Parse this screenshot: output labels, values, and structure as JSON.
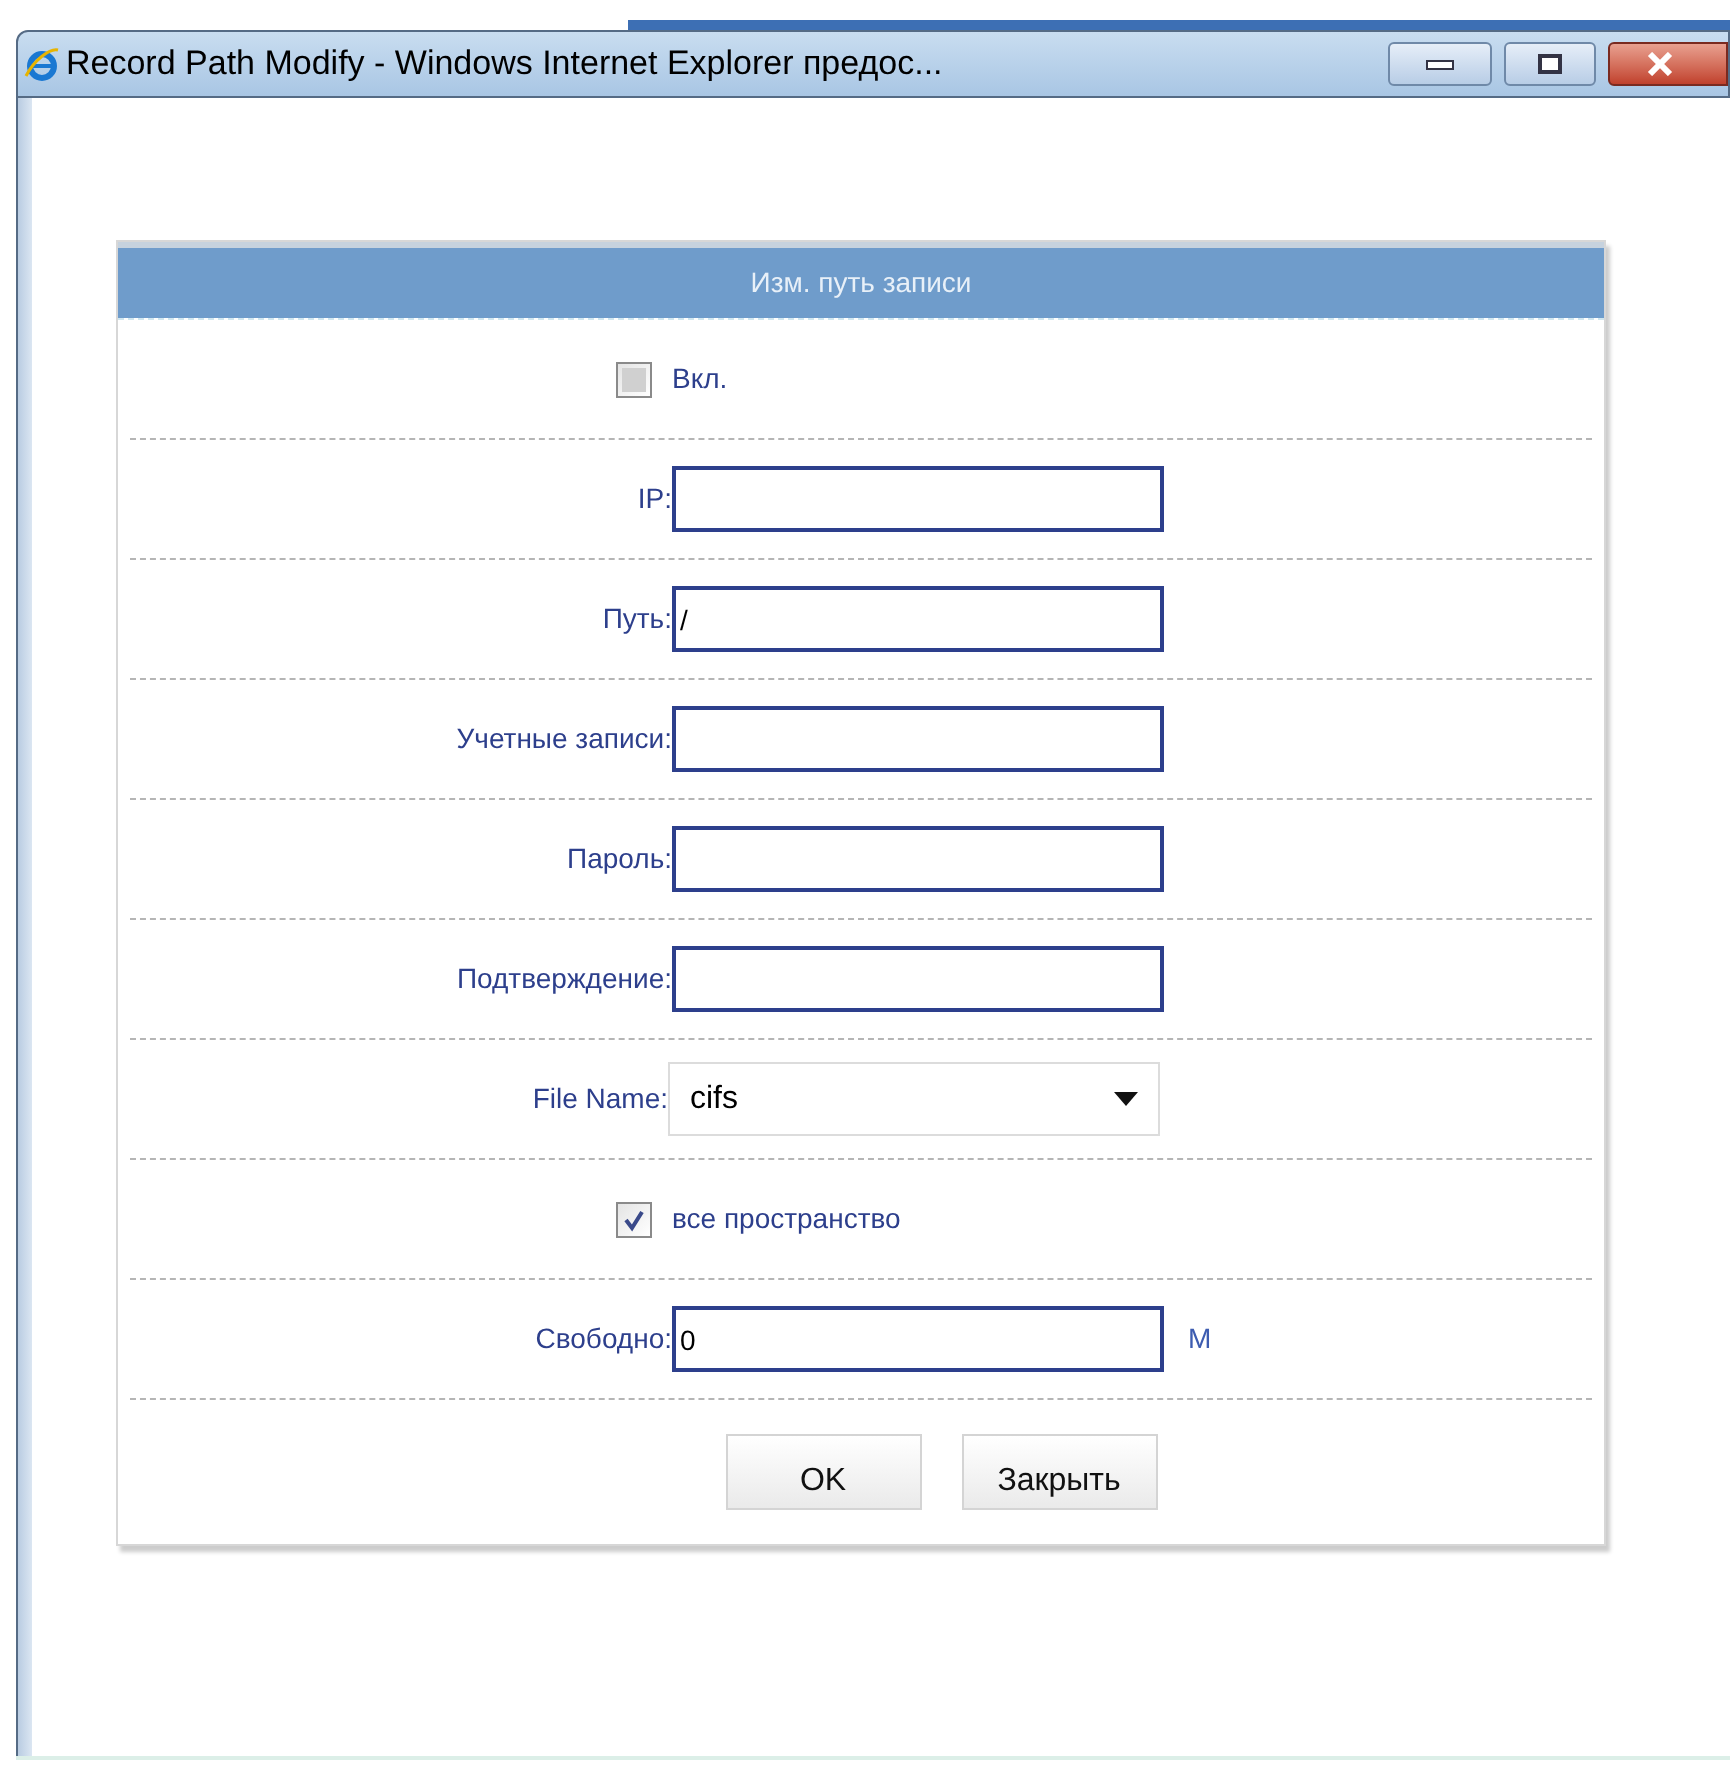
{
  "window": {
    "title": "Record Path Modify - Windows Internet Explorer предос..."
  },
  "form": {
    "title": "Изм. путь записи",
    "rows": [
      {
        "kind": "checkbox",
        "label": "Вкл.",
        "checked": false
      },
      {
        "kind": "text",
        "label": "IP:"
      },
      {
        "kind": "text",
        "label": "Путь:",
        "value": "/"
      },
      {
        "kind": "text",
        "label": "Учетные записи:"
      },
      {
        "kind": "text",
        "label": "Пароль:"
      },
      {
        "kind": "text",
        "label": "Подтверждение:"
      },
      {
        "kind": "select",
        "label": "File Name:",
        "value": "cifs"
      },
      {
        "kind": "checkbox",
        "label": "все пространство",
        "checked": true
      },
      {
        "kind": "text",
        "label": "Свободно:",
        "value": "0",
        "unit": "М"
      }
    ],
    "buttons": [
      "OK",
      "Закрыть"
    ]
  }
}
